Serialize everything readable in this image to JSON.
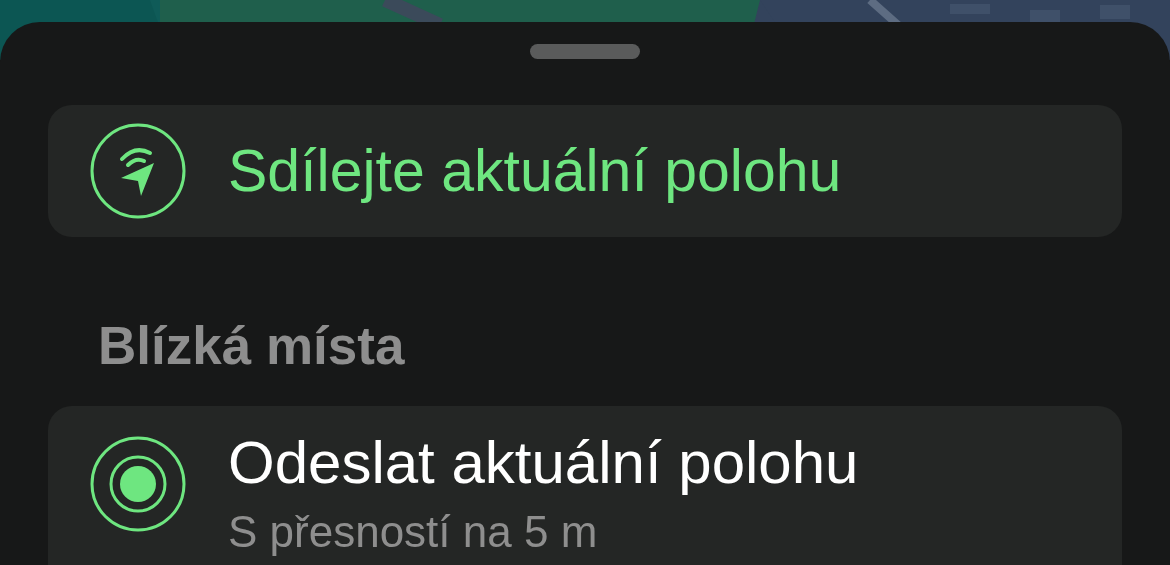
{
  "share_button": {
    "label": "Sdílejte aktuální polohu"
  },
  "section": {
    "title": "Blízká místa"
  },
  "places": [
    {
      "kind": "current",
      "title": "Odeslat aktuální polohu",
      "subtitle": "S přesností na 5 m"
    }
  ]
}
